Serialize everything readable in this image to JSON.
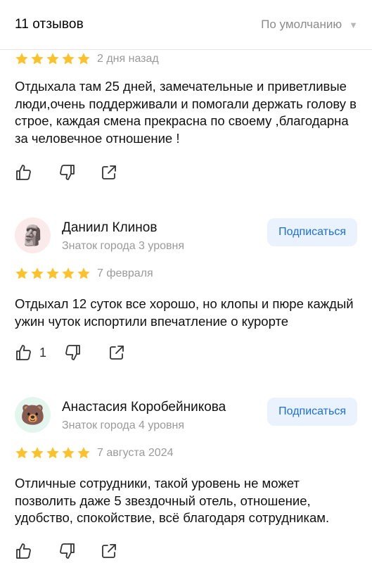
{
  "header": {
    "count_label": "11 отзывов",
    "sort_label": "По умолчанию",
    "sort_icon": "chevron-down-icon"
  },
  "colors": {
    "star": "#fbc22b",
    "subscribe_bg": "#eaf2fd",
    "subscribe_text": "#1a6fdc",
    "muted": "#9a9a9a"
  },
  "reviews": [
    {
      "rating": 5,
      "date": "2 дня назад",
      "text": "Отдыхала там 25 дней, замечательные и приветливые люди,очень поддерживали и помогали держать голову в строе, каждая смена прекрасна по своему ,благодарна за человечное отношение !",
      "likes": ""
    },
    {
      "author": "Даниил Клинов",
      "level": "Знаток города 3 уровня",
      "avatar_icon": "moai-icon",
      "avatar_glyph": "🗿",
      "subscribe_label": "Подписаться",
      "rating": 5,
      "date": "7 февраля",
      "text": "Отдыхал 12 суток все хорошо, но клопы и пюре каждый ужин чуток испортили впечатление о курорте",
      "likes": "1"
    },
    {
      "author": "Анастасия Коробейникова",
      "level": "Знаток города 4 уровня",
      "avatar_icon": "bear-icon",
      "avatar_glyph": "🐻",
      "subscribe_label": "Подписаться",
      "rating": 5,
      "date": "7 августа 2024",
      "text": "Отличные сотрудники, такой уровень не может позволить даже 5 звездочный отель, отношение, удобство, спокойствие, всё благодаря сотрудникам.",
      "likes": ""
    }
  ]
}
